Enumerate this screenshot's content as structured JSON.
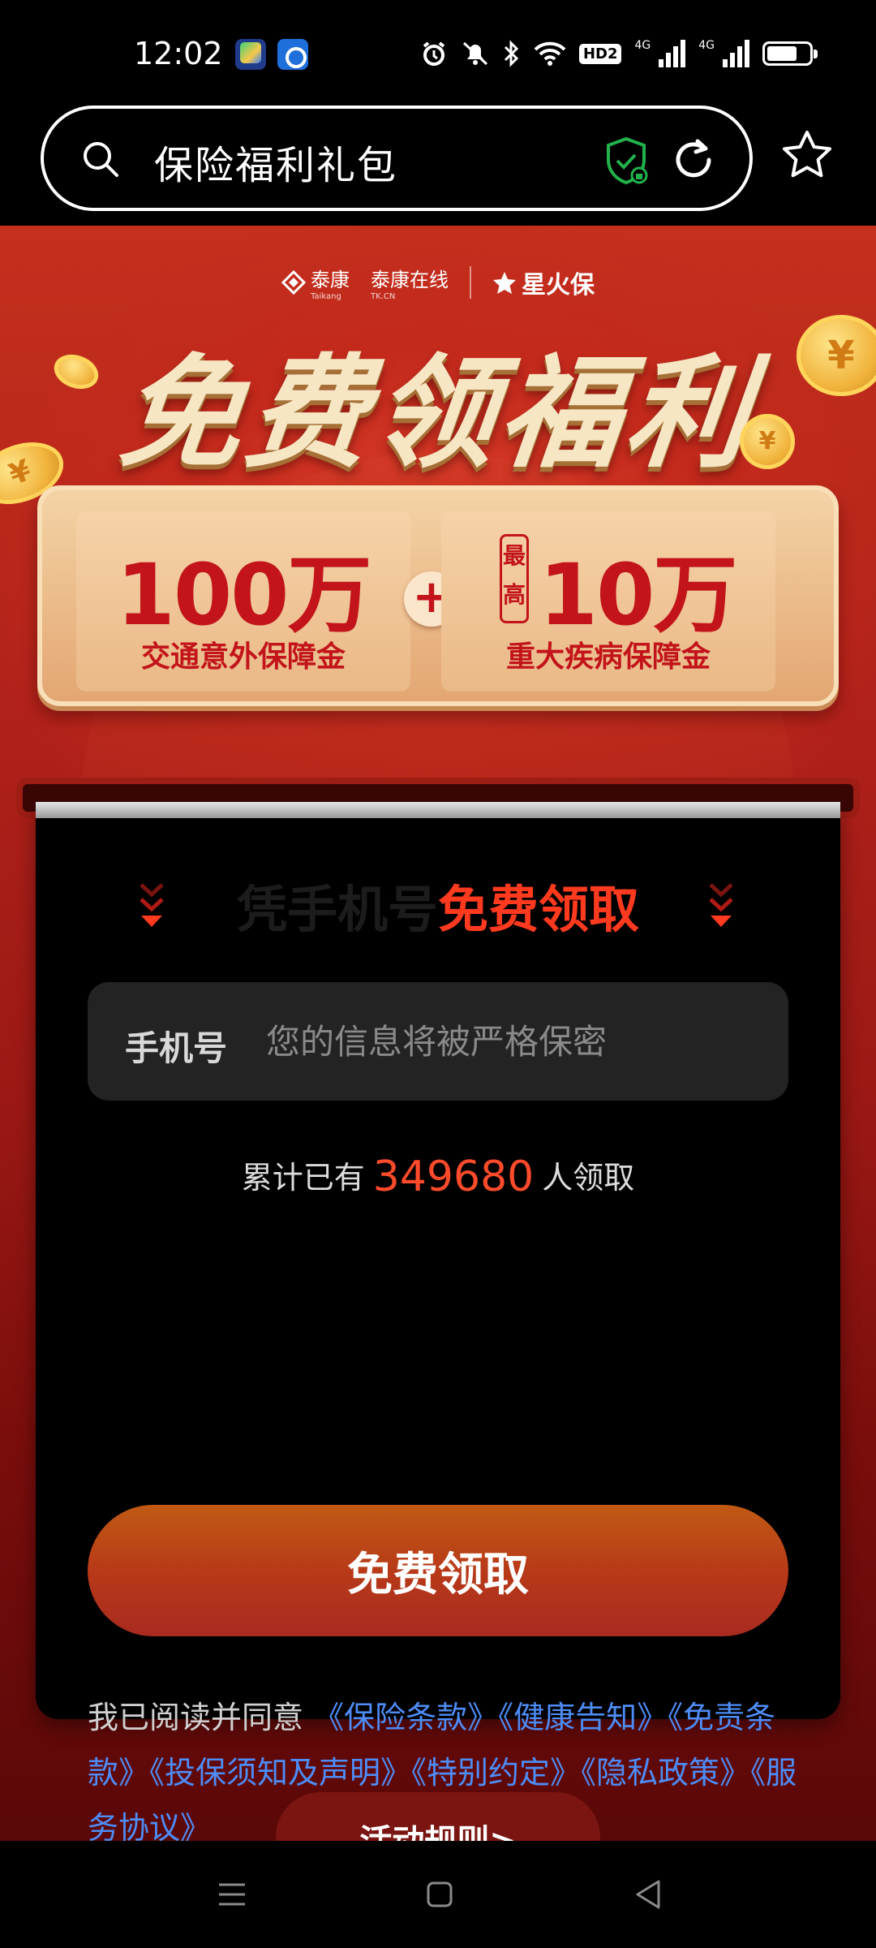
{
  "status_bar": {
    "time": "12:02",
    "network_1": "4G",
    "network_2": "4G",
    "hd_badge": "HD2",
    "battery_level": 0.72
  },
  "browser": {
    "url_text": "保险福利礼包"
  },
  "header": {
    "brands": [
      {
        "name": "泰康",
        "sub": "Taikang"
      },
      {
        "name": "泰康在线",
        "sub": "TK.CN"
      },
      {
        "name": "星火保",
        "sub": ""
      }
    ]
  },
  "hero": {
    "title": "免费领福利"
  },
  "prizes": {
    "left": {
      "amount": "100万",
      "desc": "交通意外保障金"
    },
    "right": {
      "tag": "最高",
      "amount": "10万",
      "desc": "重大疾病保障金"
    },
    "plus": "+"
  },
  "form": {
    "heading_dim": "凭手机号",
    "heading_hot": "免费领取",
    "phone_label": "手机号",
    "phone_placeholder": "您的信息将被严格保密",
    "phone_value": "",
    "count_prefix": "累计已有",
    "count_number": "349680",
    "count_suffix": "人领取",
    "submit_label": "免费领取",
    "agreement_prefix": "我已阅读并同意",
    "links": [
      "《保险条款》",
      "《健康告知》",
      "《免责条款》",
      "《投保须知及声明》",
      "《特别约定》",
      "《隐私政策》",
      "《服务协议》"
    ]
  },
  "footer": {
    "rules_label": "活动规则>"
  },
  "colors": {
    "accent_red": "#c2141a",
    "heading_hot": "#ff3a1e",
    "link_blue": "#4e8cf7",
    "button_orange": "#b83a18"
  }
}
